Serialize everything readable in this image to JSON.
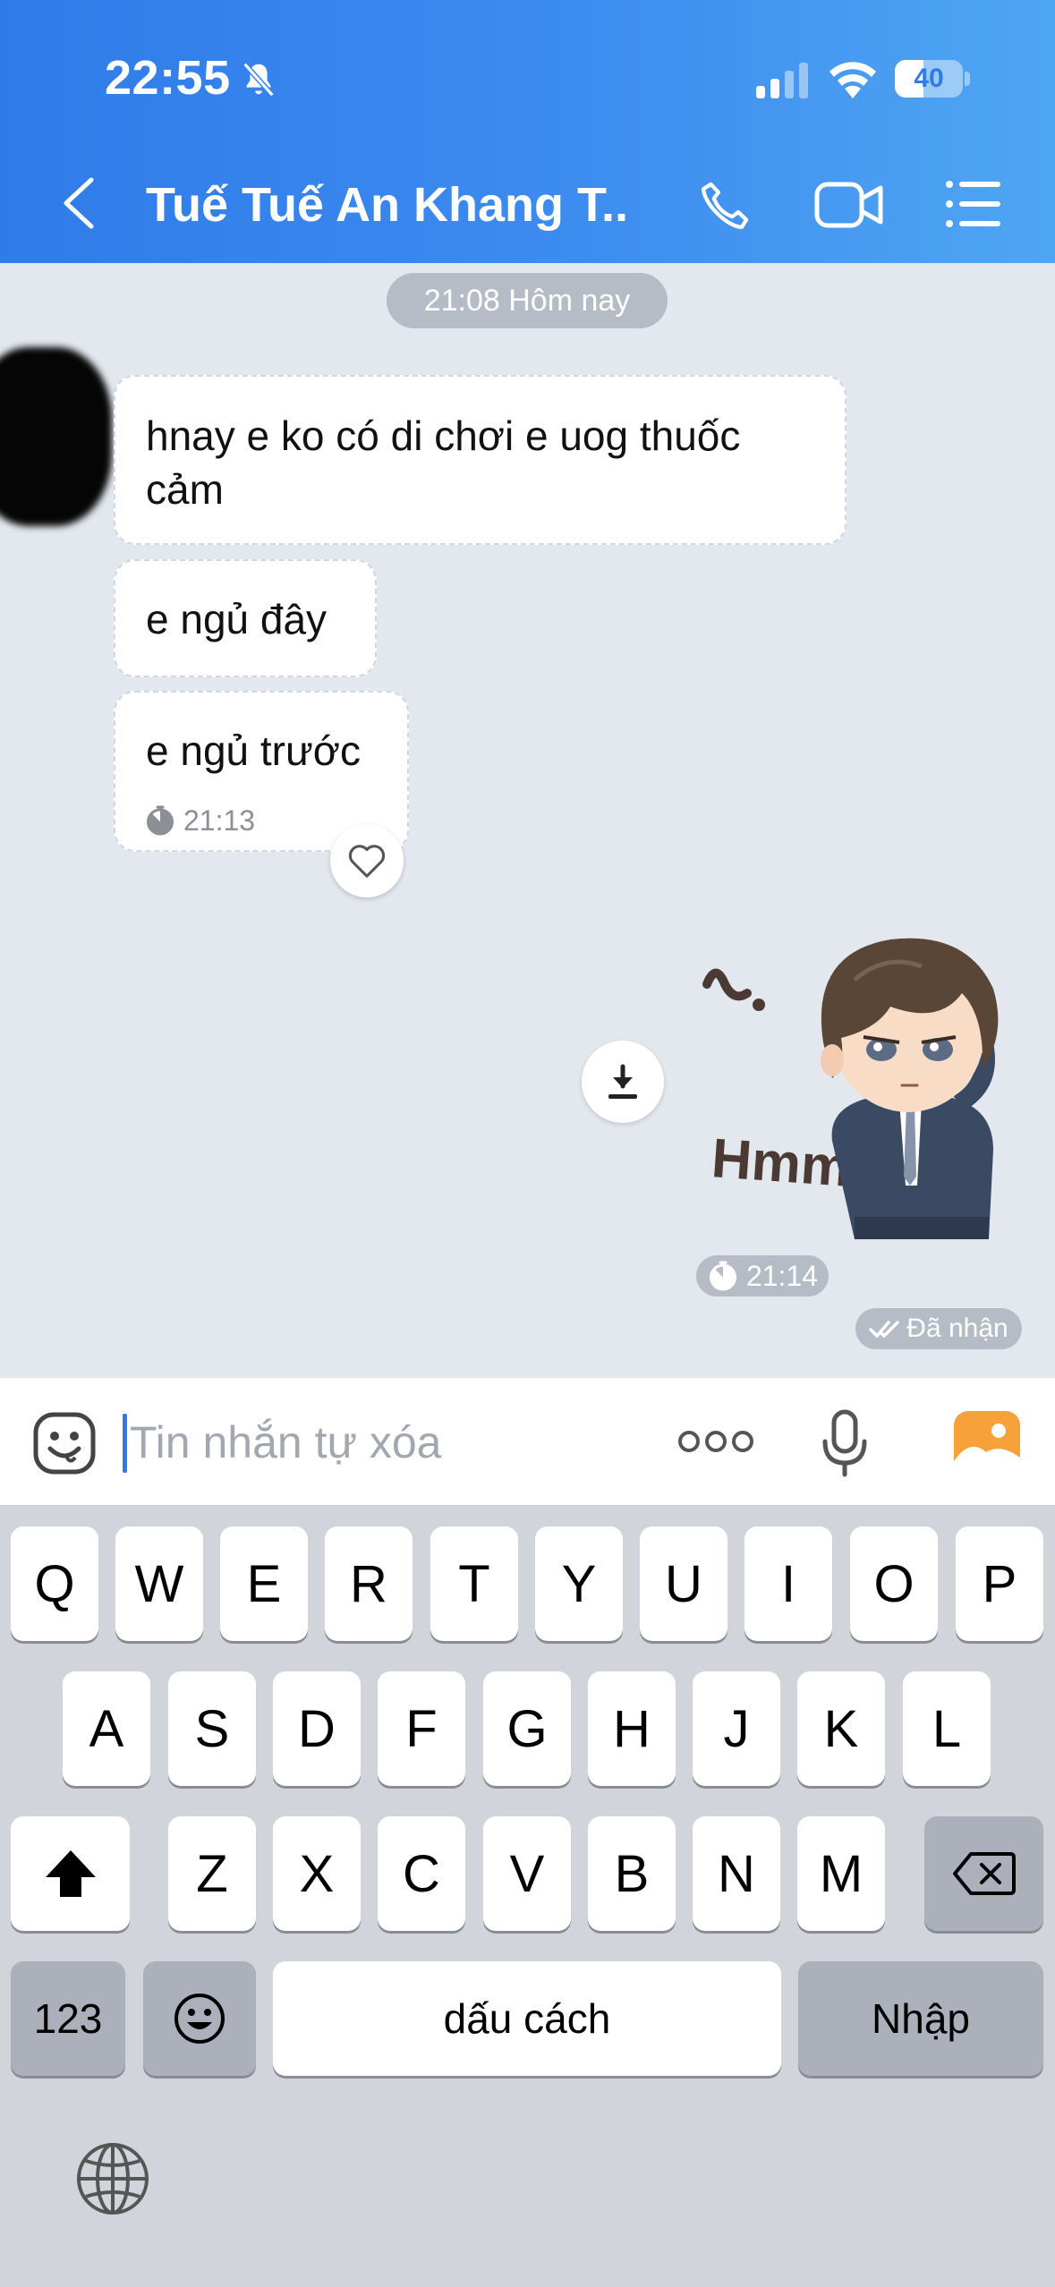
{
  "status_bar": {
    "time": "22:55",
    "battery": "40"
  },
  "header": {
    "title": "Tuế Tuế An Khang T..."
  },
  "chat": {
    "date_separator": "21:08 Hôm nay",
    "messages": [
      {
        "text": "hnay e ko có di chơi e uog thuốc cảm"
      },
      {
        "text": "e ngủ đây"
      },
      {
        "text": "e ngủ trước",
        "time": "21:13"
      }
    ],
    "sticker": {
      "text": "Hmm",
      "time": "21:14",
      "status": "Đã nhận"
    }
  },
  "input": {
    "placeholder": "Tin nhắn tự xóa"
  },
  "keyboard": {
    "row1": [
      "Q",
      "W",
      "E",
      "R",
      "T",
      "Y",
      "U",
      "I",
      "O",
      "P"
    ],
    "row2": [
      "A",
      "S",
      "D",
      "F",
      "G",
      "H",
      "J",
      "K",
      "L"
    ],
    "row3": [
      "Z",
      "X",
      "C",
      "V",
      "B",
      "N",
      "M"
    ],
    "numbers_key": "123",
    "space_key": "dấu cách",
    "return_key": "Nhập"
  },
  "colors": {
    "header_start": "#2f7be8",
    "header_end": "#4fa6f2",
    "chat_bg": "#e3e8ef",
    "accent": "#2f7be8"
  }
}
